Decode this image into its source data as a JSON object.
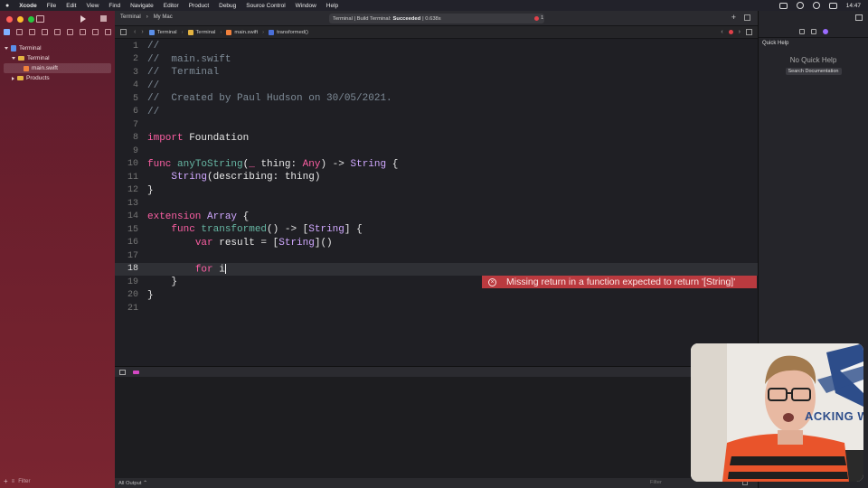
{
  "menubar": {
    "items": [
      "Xcode",
      "File",
      "Edit",
      "View",
      "Find",
      "Navigate",
      "Editor",
      "Product",
      "Debug",
      "Source Control",
      "Window",
      "Help"
    ],
    "clock": "14:47"
  },
  "toolbar": {
    "scheme": "Terminal",
    "destination": "My Mac",
    "status_prefix": "Terminal | Build Terminal:",
    "status_result": "Succeeded",
    "status_time": "| 0.638s",
    "error_count": "1"
  },
  "navigator": {
    "items": [
      {
        "label": "Terminal",
        "level": 0,
        "kind": "project"
      },
      {
        "label": "Terminal",
        "level": 1,
        "kind": "folder"
      },
      {
        "label": "main.swift",
        "level": 2,
        "kind": "swift"
      },
      {
        "label": "Products",
        "level": 1,
        "kind": "folder"
      }
    ],
    "filter_placeholder": "Filter"
  },
  "jumpbar": {
    "crumbs": [
      "Terminal",
      "Terminal",
      "main.swift",
      "transformed()"
    ]
  },
  "editor": {
    "lines": [
      {
        "n": "1",
        "text": "//"
      },
      {
        "n": "2",
        "text": "//  main.swift"
      },
      {
        "n": "3",
        "text": "//  Terminal"
      },
      {
        "n": "4",
        "text": "//"
      },
      {
        "n": "5",
        "text": "//  Created by Paul Hudson on 30/05/2021."
      },
      {
        "n": "6",
        "text": "//"
      },
      {
        "n": "7",
        "text": ""
      },
      {
        "n": "8",
        "text": "import Foundation"
      },
      {
        "n": "9",
        "text": ""
      },
      {
        "n": "10",
        "text": "func anyToString(_ thing: Any) -> String {"
      },
      {
        "n": "11",
        "text": "    String(describing: thing)"
      },
      {
        "n": "12",
        "text": "}"
      },
      {
        "n": "13",
        "text": ""
      },
      {
        "n": "14",
        "text": "extension Array {"
      },
      {
        "n": "15",
        "text": "    func transformed() -> [String] {"
      },
      {
        "n": "16",
        "text": "        var result = [String]()"
      },
      {
        "n": "17",
        "text": ""
      },
      {
        "n": "18",
        "text": "        for i"
      },
      {
        "n": "19",
        "text": "    }"
      },
      {
        "n": "20",
        "text": "}"
      },
      {
        "n": "21",
        "text": ""
      }
    ],
    "error_message": "Missing return in a function expected to return '[String]'"
  },
  "console": {
    "output_selector": "All Output ⌃",
    "filter_placeholder": "Filter"
  },
  "inspector": {
    "title": "Quick Help",
    "empty_text": "No Quick Help",
    "search_button": "Search Documentation"
  },
  "webcam": {
    "background_text": "ACKING WIT"
  }
}
